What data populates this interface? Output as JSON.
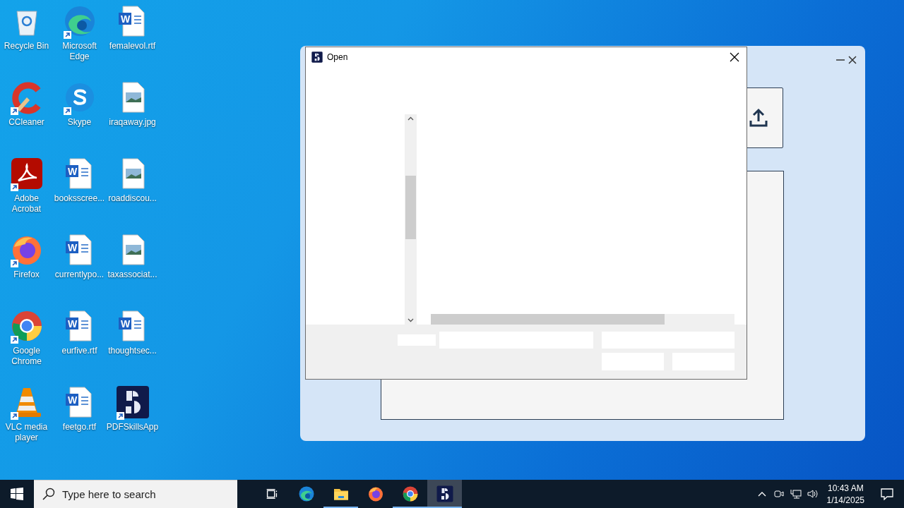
{
  "desktop_icons": [
    {
      "label": "Recycle Bin",
      "kind": "recycle",
      "shortcut": false
    },
    {
      "label": "Microsoft Edge",
      "kind": "edge",
      "shortcut": true
    },
    {
      "label": "femalevol.rtf",
      "kind": "word",
      "letter": "W",
      "shortcut": false
    },
    {
      "label": "CCleaner",
      "kind": "ccleaner",
      "shortcut": true
    },
    {
      "label": "Skype",
      "kind": "skype",
      "shortcut": true
    },
    {
      "label": "iraqaway.jpg",
      "kind": "image",
      "shortcut": false
    },
    {
      "label": "Adobe Acrobat",
      "kind": "acrobat",
      "shortcut": true
    },
    {
      "label": "booksscree...",
      "kind": "word",
      "letter": "W",
      "shortcut": false
    },
    {
      "label": "roaddiscou...",
      "kind": "image",
      "shortcut": false
    },
    {
      "label": "Firefox",
      "kind": "firefox",
      "shortcut": true
    },
    {
      "label": "currentlypo...",
      "kind": "word",
      "letter": "W",
      "shortcut": false
    },
    {
      "label": "taxassociat...",
      "kind": "image",
      "shortcut": false
    },
    {
      "label": "Google Chrome",
      "kind": "chrome",
      "shortcut": true
    },
    {
      "label": "eurfive.rtf",
      "kind": "word",
      "letter": "W",
      "shortcut": false
    },
    {
      "label": "thoughtsec...",
      "kind": "word",
      "letter": "W",
      "shortcut": false
    },
    {
      "label": "VLC media player",
      "kind": "vlc",
      "shortcut": true
    },
    {
      "label": "feetgo.rtf",
      "kind": "word",
      "letter": "W",
      "shortcut": false
    },
    {
      "label": "PDFSkillsApp",
      "kind": "pdfskills",
      "shortcut": true
    }
  ],
  "dialog": {
    "title": "Open"
  },
  "taskbar": {
    "search": {
      "placeholder": "Type here to search"
    },
    "apps": [
      {
        "kind": "taskview",
        "running": false,
        "selected": false
      },
      {
        "kind": "edge",
        "running": false,
        "selected": false
      },
      {
        "kind": "explorer",
        "running": true,
        "selected": false
      },
      {
        "kind": "firefox",
        "running": false,
        "selected": false
      },
      {
        "kind": "chrome",
        "running": true,
        "selected": false
      },
      {
        "kind": "pdfskills",
        "running": true,
        "selected": true
      }
    ],
    "clock": {
      "time": "10:43 AM",
      "date": "1/14/2025"
    }
  }
}
